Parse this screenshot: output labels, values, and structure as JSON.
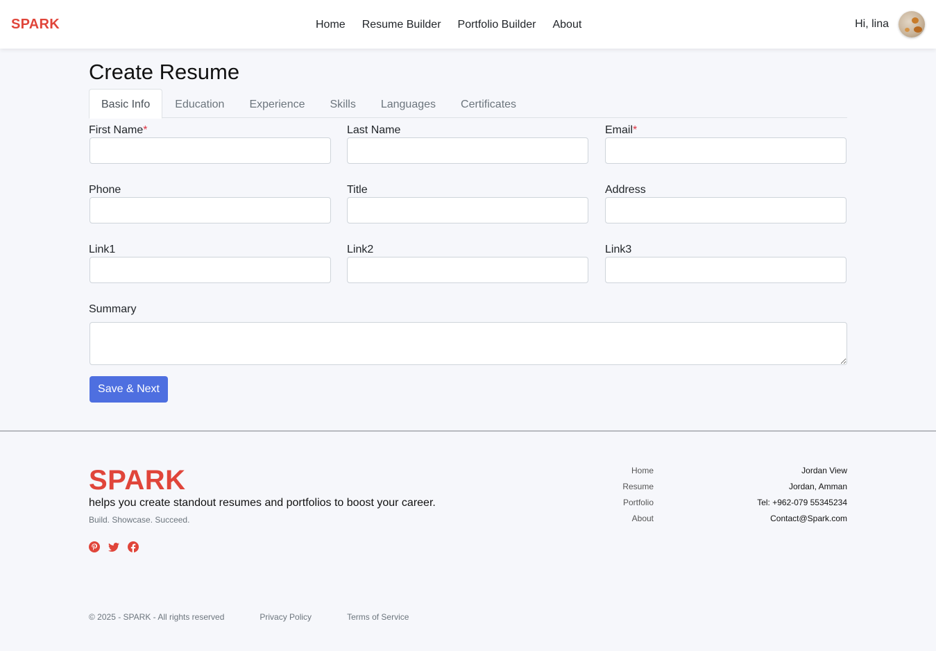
{
  "header": {
    "brand": "SPARK",
    "nav": [
      "Home",
      "Resume Builder",
      "Portfolio Builder",
      "About"
    ],
    "greeting": "Hi, lina"
  },
  "main": {
    "title": "Create Resume",
    "tabs": [
      "Basic Info",
      "Education",
      "Experience",
      "Skills",
      "Languages",
      "Certificates"
    ],
    "active_tab": "Basic Info",
    "fields": {
      "first_name": {
        "label": "First Name",
        "required": "*",
        "value": ""
      },
      "last_name": {
        "label": "Last Name",
        "value": ""
      },
      "email": {
        "label": "Email",
        "required": "*",
        "value": ""
      },
      "phone": {
        "label": "Phone",
        "value": ""
      },
      "title": {
        "label": "Title",
        "value": ""
      },
      "address": {
        "label": "Address",
        "value": ""
      },
      "link1": {
        "label": "Link1",
        "value": ""
      },
      "link2": {
        "label": "Link2",
        "value": ""
      },
      "link3": {
        "label": "Link3",
        "value": ""
      },
      "summary": {
        "label": "Summary",
        "value": ""
      }
    },
    "save_button": "Save & Next"
  },
  "footer": {
    "brand": "SPARK",
    "tagline": "helps you create standout resumes and portfolios to boost your career.",
    "motto": "Build. Showcase. Succeed.",
    "social_icons": [
      "pinterest-icon",
      "twitter-icon",
      "facebook-icon"
    ],
    "links": [
      "Home",
      "Resume",
      "Portfolio",
      "About"
    ],
    "contact": [
      "Jordan View",
      "Jordan, Amman",
      "Tel: +962-079 55345234",
      "Contact@Spark.com"
    ],
    "copyright": "© 2025 - SPARK - All rights reserved",
    "privacy": "Privacy Policy",
    "terms": "Terms of Service"
  },
  "colors": {
    "brand": "#e0453a",
    "primary_button": "#4e6fe0",
    "required_marker": "#dc3545",
    "background": "#f6f7fb"
  }
}
